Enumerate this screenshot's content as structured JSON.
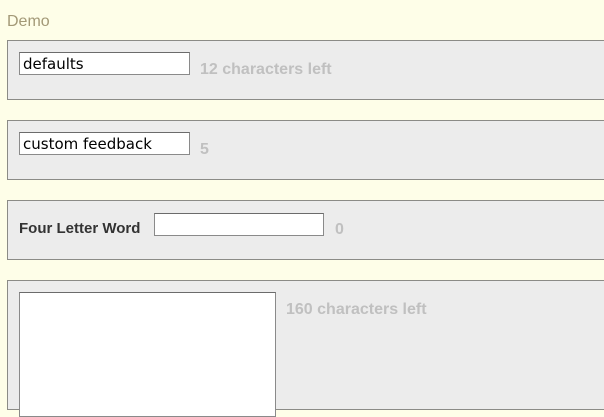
{
  "page": {
    "heading": "Demo"
  },
  "fields": {
    "defaults": {
      "value": "defaults",
      "feedback": "12 characters left"
    },
    "custom": {
      "value": "custom feedback",
      "feedback": "5"
    },
    "four_letter": {
      "label": "Four Letter Word",
      "value": "",
      "feedback": "0"
    },
    "textarea": {
      "value": "",
      "feedback": "160 characters left"
    }
  },
  "colors": {
    "page_background": "#fefee8",
    "panel_background": "#ececec",
    "panel_border": "#8b8b86",
    "heading": "#a39977",
    "feedback": "#c0c0c0",
    "label": "#333333"
  }
}
